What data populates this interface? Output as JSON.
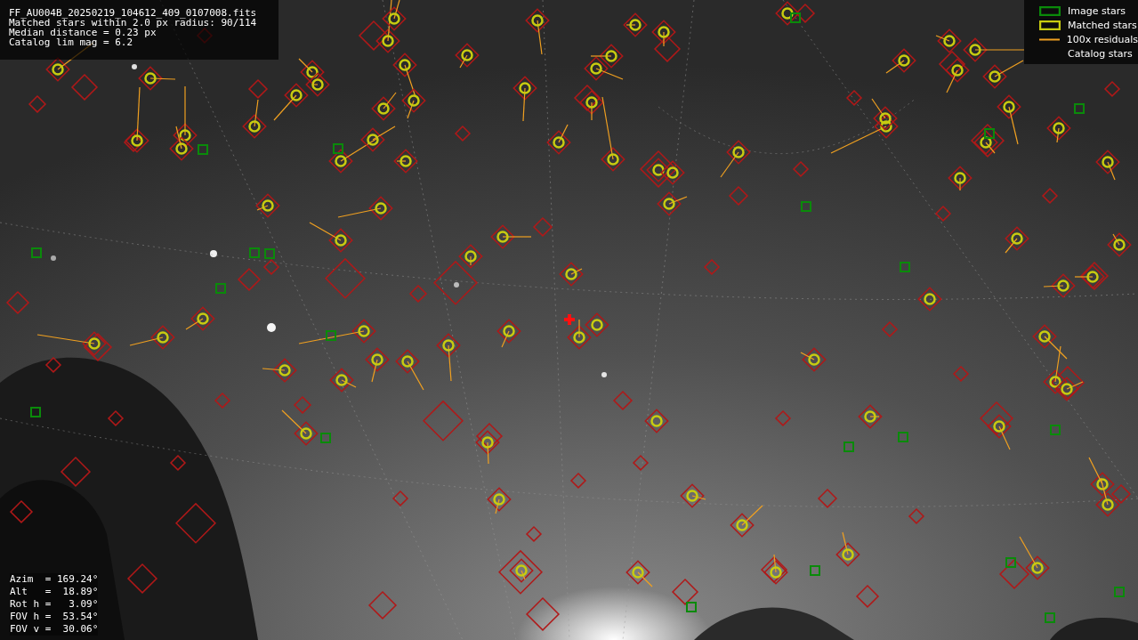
{
  "info_lines": [
    "FF_AU004B_20250219_104612_409_0107008.fits",
    "Matched stars within 2.0 px radius: 90/114",
    "Median distance = 0.23 px",
    "Catalog lim mag = 6.2"
  ],
  "legend": [
    {
      "label": "Image stars"
    },
    {
      "kind": "matched",
      "label": "Matched stars"
    },
    {
      "kind": "residual",
      "label": "100x residuals"
    },
    {
      "kind": "catalog",
      "label": "Catalog stars"
    }
  ],
  "pointing": [
    "Azim  = 169.24°",
    "Alt   =  18.89°",
    "Rot h =   3.09°",
    "FOV h =  53.54°",
    "FOV v =  30.06°"
  ]
}
